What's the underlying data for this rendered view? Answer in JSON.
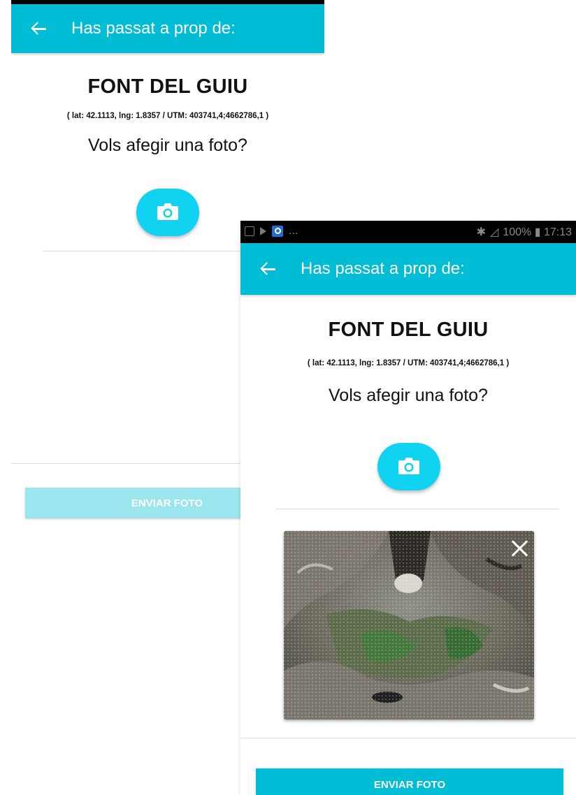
{
  "screen_a": {
    "appbar": {
      "title": "Has passat a prop de:"
    },
    "place_name": "FONT DEL GUIU",
    "coordinates": "( lat: 42.1113, lng: 1.8357 / UTM: 403741,4;4662786,1 )",
    "question": "Vols afegir una foto?",
    "send_button": {
      "label": "ENVIAR FOTO",
      "state": "disabled",
      "color": "#9be5ee"
    }
  },
  "screen_b": {
    "status_bar": {
      "right_text": "100% ▮ 17:13",
      "left_text": "..."
    },
    "appbar": {
      "title": "Has passat a prop de:"
    },
    "place_name": "FONT DEL GUIU",
    "coordinates": "( lat: 42.1113, lng: 1.8357 / UTM: 403741,4;4662786,1 )",
    "question": "Vols afegir una foto?",
    "send_button": {
      "label": "ENVIAR FOTO",
      "state": "enabled",
      "color": "#00bcd4"
    }
  },
  "colors": {
    "primary": "#00bcd4",
    "camera_button": "#0fd3f0",
    "divider": "#dcdcdc"
  },
  "icons": {
    "back": "arrow-back-icon",
    "camera": "camera-icon",
    "close": "close-icon"
  }
}
